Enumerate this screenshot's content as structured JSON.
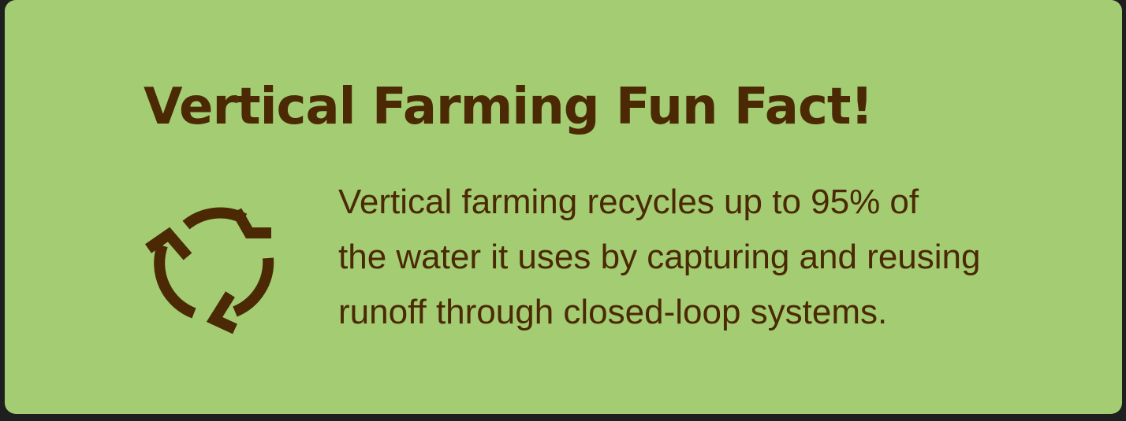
{
  "card": {
    "title": "Vertical Farming Fun Fact!",
    "icon": "recycle-icon",
    "body_lines": [
      "Vertical farming recycles up to 95% of",
      "the water it uses by capturing and reusing",
      "runoff through closed-loop systems."
    ]
  },
  "colors": {
    "card_background": "#a3cc73",
    "text": "#4a2904",
    "page_background": "#1f1f1f"
  }
}
